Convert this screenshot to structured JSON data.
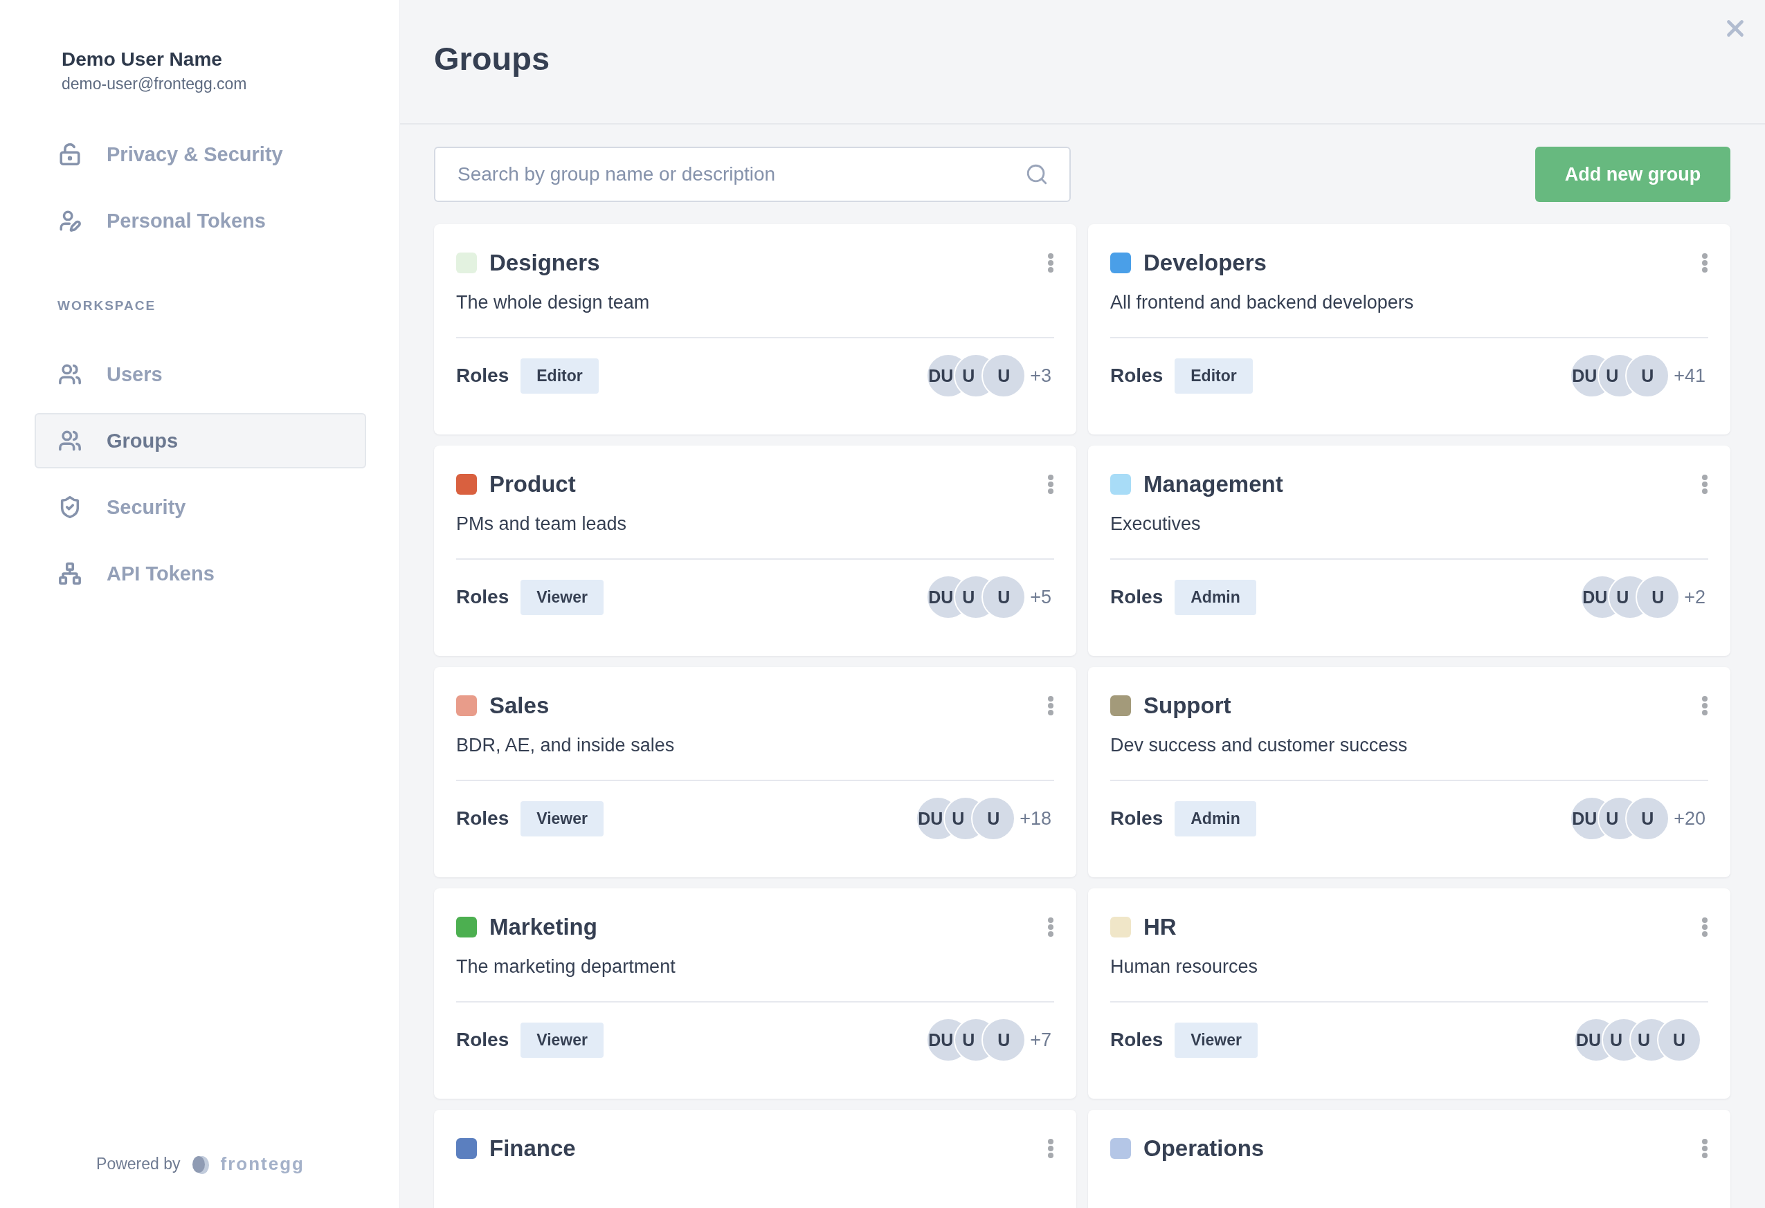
{
  "user": {
    "name": "Demo User Name",
    "email": "demo-user@frontegg.com"
  },
  "sidebar": {
    "personal_items": [
      {
        "label": "Privacy & Security",
        "selected": false
      },
      {
        "label": "Personal Tokens",
        "selected": false
      }
    ],
    "section_title": "WORKSPACE",
    "workspace_items": [
      {
        "label": "Users",
        "selected": false
      },
      {
        "label": "Groups",
        "selected": true
      },
      {
        "label": "Security",
        "selected": false
      },
      {
        "label": "API Tokens",
        "selected": false
      }
    ],
    "footer": {
      "powered_by": "Powered by",
      "brand": "frontegg"
    }
  },
  "page": {
    "title": "Groups",
    "search": {
      "placeholder": "Search by group name or description"
    },
    "add_button": "Add new group"
  },
  "groups": [
    {
      "name": "Designers",
      "color": "#e3f2e0",
      "description": "The whole design team",
      "roles_label": "Roles",
      "role": "Editor",
      "avatars": [
        "DU",
        "U",
        "U"
      ],
      "more": "+3"
    },
    {
      "name": "Developers",
      "color": "#4a9fe8",
      "description": "All frontend and backend developers",
      "roles_label": "Roles",
      "role": "Editor",
      "avatars": [
        "DU",
        "U",
        "U"
      ],
      "more": "+41"
    },
    {
      "name": "Product",
      "color": "#d9603f",
      "description": "PMs and team leads",
      "roles_label": "Roles",
      "role": "Viewer",
      "avatars": [
        "DU",
        "U",
        "U"
      ],
      "more": "+5"
    },
    {
      "name": "Management",
      "color": "#a8dcf7",
      "description": "Executives",
      "roles_label": "Roles",
      "role": "Admin",
      "avatars": [
        "DU",
        "U",
        "U"
      ],
      "more": "+2"
    },
    {
      "name": "Sales",
      "color": "#e89c8a",
      "description": "BDR, AE, and inside sales",
      "roles_label": "Roles",
      "role": "Viewer",
      "avatars": [
        "DU",
        "U",
        "U"
      ],
      "more": "+18"
    },
    {
      "name": "Support",
      "color": "#a39a7a",
      "description": "Dev success and customer success",
      "roles_label": "Roles",
      "role": "Admin",
      "avatars": [
        "DU",
        "U",
        "U"
      ],
      "more": "+20"
    },
    {
      "name": "Marketing",
      "color": "#4caf50",
      "description": "The marketing department",
      "roles_label": "Roles",
      "role": "Viewer",
      "avatars": [
        "DU",
        "U",
        "U"
      ],
      "more": "+7"
    },
    {
      "name": "HR",
      "color": "#f0e6c8",
      "description": "Human resources",
      "roles_label": "Roles",
      "role": "Viewer",
      "avatars": [
        "DU",
        "U",
        "U",
        "U"
      ]
    },
    {
      "name": "Finance",
      "color": "#5b7fbf"
    },
    {
      "name": "Operations",
      "color": "#b4c6e6"
    }
  ]
}
